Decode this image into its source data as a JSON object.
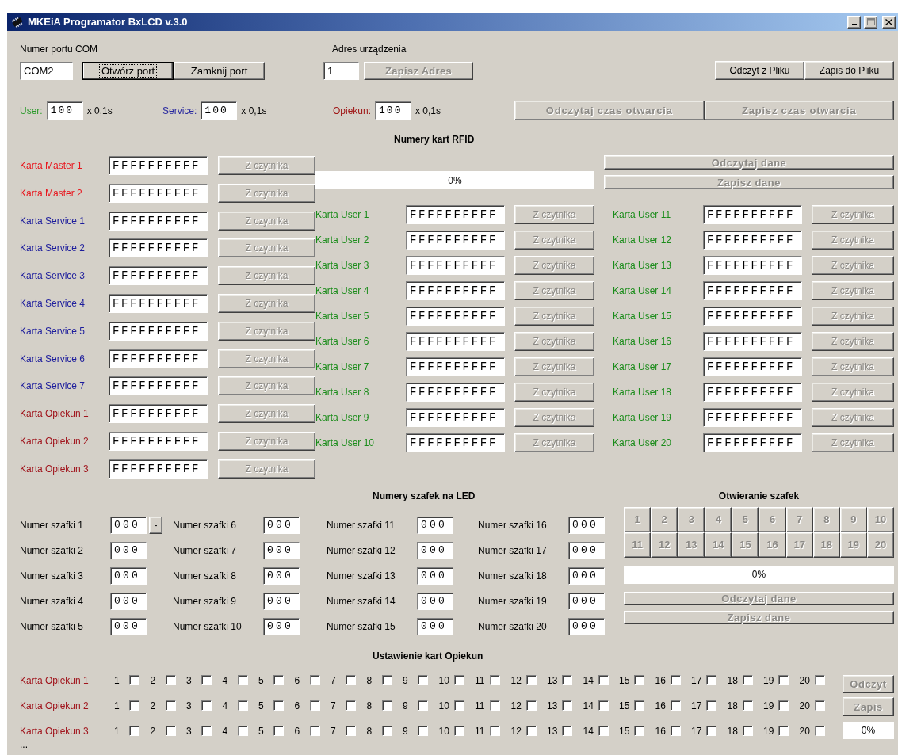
{
  "window": {
    "title": "MKEiA Programator BxLCD v.3.0"
  },
  "com": {
    "label": "Numer portu COM",
    "value": "COM2",
    "buttons": [
      {
        "label": "Otwórz port",
        "focused": true,
        "disabled": false
      },
      {
        "label": "Zamknij port",
        "focused": false,
        "disabled": false
      }
    ]
  },
  "address": {
    "label": "Adres urządzenia",
    "value": "1",
    "button": {
      "label": "Zapisz Adres",
      "focused": false,
      "disabled": true
    }
  },
  "file_buttons": [
    {
      "label": "Odczyt z Pliku",
      "focused": false,
      "disabled": false
    },
    {
      "label": "Zapis do Pliku",
      "focused": false,
      "disabled": false
    }
  ],
  "timers": [
    {
      "label": "User:",
      "value": "100",
      "unit": "x 0,1s",
      "color": "#2a9a2a"
    },
    {
      "label": "Service:",
      "value": "100",
      "unit": "x 0,1s",
      "color": "#2a2aa0"
    },
    {
      "label": "Opiekun:",
      "value": "100",
      "unit": "x 0,1s",
      "color": "#a01818"
    }
  ],
  "timer_buttons": [
    {
      "label": "Odczytaj czas otwarcia",
      "focused": false,
      "disabled": true
    },
    {
      "label": "Zapisz czas otwarcia",
      "focused": false,
      "disabled": true
    }
  ],
  "rfid": {
    "title": "Numery kart RFID",
    "progress": {
      "level": 0,
      "text": "0%"
    },
    "buttons": [
      {
        "label": "Odczytaj dane",
        "focused": false,
        "disabled": true
      },
      {
        "label": "Zapisz dane",
        "focused": false,
        "disabled": true
      }
    ],
    "cards": [
      {
        "label": "Karta Master 1",
        "value": "FFFFFFFFFF",
        "color": "#e8141c",
        "button": {
          "label": "Z czytnika",
          "focused": false,
          "disabled": true
        }
      },
      {
        "label": "Karta Master 2",
        "value": "FFFFFFFFFF",
        "color": "#e8141c",
        "button": {
          "label": "Z czytnika",
          "focused": false,
          "disabled": true
        }
      },
      {
        "label": "Karta Service 1",
        "value": "FFFFFFFFFF",
        "color": "#1c1c9c",
        "button": {
          "label": "Z czytnika",
          "focused": false,
          "disabled": true
        }
      },
      {
        "label": "Karta Service 2",
        "value": "FFFFFFFFFF",
        "color": "#1c1c9c",
        "button": {
          "label": "Z czytnika",
          "focused": false,
          "disabled": true
        }
      },
      {
        "label": "Karta Service 3",
        "value": "FFFFFFFFFF",
        "color": "#1c1c9c",
        "button": {
          "label": "Z czytnika",
          "focused": false,
          "disabled": true
        }
      },
      {
        "label": "Karta Service 4",
        "value": "FFFFFFFFFF",
        "color": "#1c1c9c",
        "button": {
          "label": "Z czytnika",
          "focused": false,
          "disabled": true
        }
      },
      {
        "label": "Karta Service 5",
        "value": "FFFFFFFFFF",
        "color": "#1c1c9c",
        "button": {
          "label": "Z czytnika",
          "focused": false,
          "disabled": true
        }
      },
      {
        "label": "Karta Service 6",
        "value": "FFFFFFFFFF",
        "color": "#1c1c9c",
        "button": {
          "label": "Z czytnika",
          "focused": false,
          "disabled": true
        }
      },
      {
        "label": "Karta Service 7",
        "value": "FFFFFFFFFF",
        "color": "#1c1c9c",
        "button": {
          "label": "Z czytnika",
          "focused": false,
          "disabled": true
        }
      },
      {
        "label": "Karta Opiekun 1",
        "value": "FFFFFFFFFF",
        "color": "#a0141c",
        "button": {
          "label": "Z czytnika",
          "focused": false,
          "disabled": true
        }
      },
      {
        "label": "Karta Opiekun 2",
        "value": "FFFFFFFFFF",
        "color": "#a0141c",
        "button": {
          "label": "Z czytnika",
          "focused": false,
          "disabled": true
        }
      },
      {
        "label": "Karta Opiekun 3",
        "value": "FFFFFFFFFF",
        "color": "#a0141c",
        "button": {
          "label": "Z czytnika",
          "focused": false,
          "disabled": true
        }
      }
    ],
    "user_cards": [
      {
        "label": "Karta User 1",
        "value": "FFFFFFFFFF",
        "color": "#1a8c1a",
        "button": {
          "label": "Z czytnika",
          "focused": false,
          "disabled": true
        }
      },
      {
        "label": "Karta User 2",
        "value": "FFFFFFFFFF",
        "color": "#1a8c1a",
        "button": {
          "label": "Z czytnika",
          "focused": false,
          "disabled": true
        }
      },
      {
        "label": "Karta User 3",
        "value": "FFFFFFFFFF",
        "color": "#1a8c1a",
        "button": {
          "label": "Z czytnika",
          "focused": false,
          "disabled": true
        }
      },
      {
        "label": "Karta User 4",
        "value": "FFFFFFFFFF",
        "color": "#1a8c1a",
        "button": {
          "label": "Z czytnika",
          "focused": false,
          "disabled": true
        }
      },
      {
        "label": "Karta User 5",
        "value": "FFFFFFFFFF",
        "color": "#1a8c1a",
        "button": {
          "label": "Z czytnika",
          "focused": false,
          "disabled": true
        }
      },
      {
        "label": "Karta User 6",
        "value": "FFFFFFFFFF",
        "color": "#1a8c1a",
        "button": {
          "label": "Z czytnika",
          "focused": false,
          "disabled": true
        }
      },
      {
        "label": "Karta User 7",
        "value": "FFFFFFFFFF",
        "color": "#1a8c1a",
        "button": {
          "label": "Z czytnika",
          "focused": false,
          "disabled": true
        }
      },
      {
        "label": "Karta User 8",
        "value": "FFFFFFFFFF",
        "color": "#1a8c1a",
        "button": {
          "label": "Z czytnika",
          "focused": false,
          "disabled": true
        }
      },
      {
        "label": "Karta User 9",
        "value": "FFFFFFFFFF",
        "color": "#1a8c1a",
        "button": {
          "label": "Z czytnika",
          "focused": false,
          "disabled": true
        }
      },
      {
        "label": "Karta User 10",
        "value": "FFFFFFFFFF",
        "color": "#1a8c1a",
        "button": {
          "label": "Z czytnika",
          "focused": false,
          "disabled": true
        }
      },
      {
        "label": "Karta User 11",
        "value": "FFFFFFFFFF",
        "color": "#1a8c1a",
        "button": {
          "label": "Z czytnika",
          "focused": false,
          "disabled": true
        }
      },
      {
        "label": "Karta User 12",
        "value": "FFFFFFFFFF",
        "color": "#1a8c1a",
        "button": {
          "label": "Z czytnika",
          "focused": false,
          "disabled": true
        }
      },
      {
        "label": "Karta User 13",
        "value": "FFFFFFFFFF",
        "color": "#1a8c1a",
        "button": {
          "label": "Z czytnika",
          "focused": false,
          "disabled": true
        }
      },
      {
        "label": "Karta User 14",
        "value": "FFFFFFFFFF",
        "color": "#1a8c1a",
        "button": {
          "label": "Z czytnika",
          "focused": false,
          "disabled": true
        }
      },
      {
        "label": "Karta User 15",
        "value": "FFFFFFFFFF",
        "color": "#1a8c1a",
        "button": {
          "label": "Z czytnika",
          "focused": false,
          "disabled": true
        }
      },
      {
        "label": "Karta User 16",
        "value": "FFFFFFFFFF",
        "color": "#1a8c1a",
        "button": {
          "label": "Z czytnika",
          "focused": false,
          "disabled": true
        }
      },
      {
        "label": "Karta User 17",
        "value": "FFFFFFFFFF",
        "color": "#1a8c1a",
        "button": {
          "label": "Z czytnika",
          "focused": false,
          "disabled": true
        }
      },
      {
        "label": "Karta User 18",
        "value": "FFFFFFFFFF",
        "color": "#1a8c1a",
        "button": {
          "label": "Z czytnika",
          "focused": false,
          "disabled": true
        }
      },
      {
        "label": "Karta User 19",
        "value": "FFFFFFFFFF",
        "color": "#1a8c1a",
        "button": {
          "label": "Z czytnika",
          "focused": false,
          "disabled": true
        }
      },
      {
        "label": "Karta User 20",
        "value": "FFFFFFFFFF",
        "color": "#1a8c1a",
        "button": {
          "label": "Z czytnika",
          "focused": false,
          "disabled": true
        }
      }
    ]
  },
  "led": {
    "title": "Numery szafek na LED",
    "extra_button": {
      "label": "-",
      "focused": false,
      "disabled": false
    },
    "lockers": [
      {
        "label": "Numer szafki 1",
        "value": "000"
      },
      {
        "label": "Numer szafki 2",
        "value": "000"
      },
      {
        "label": "Numer szafki 3",
        "value": "000"
      },
      {
        "label": "Numer szafki 4",
        "value": "000"
      },
      {
        "label": "Numer szafki 5",
        "value": "000"
      },
      {
        "label": "Numer szafki 6",
        "value": "000"
      },
      {
        "label": "Numer szafki 7",
        "value": "000"
      },
      {
        "label": "Numer szafki 8",
        "value": "000"
      },
      {
        "label": "Numer szafki 9",
        "value": "000"
      },
      {
        "label": "Numer szafki 10",
        "value": "000"
      },
      {
        "label": "Numer szafki 11",
        "value": "000"
      },
      {
        "label": "Numer szafki 12",
        "value": "000"
      },
      {
        "label": "Numer szafki 13",
        "value": "000"
      },
      {
        "label": "Numer szafki 14",
        "value": "000"
      },
      {
        "label": "Numer szafki 15",
        "value": "000"
      },
      {
        "label": "Numer szafki 16",
        "value": "000"
      },
      {
        "label": "Numer szafki 17",
        "value": "000"
      },
      {
        "label": "Numer szafki 18",
        "value": "000"
      },
      {
        "label": "Numer szafki 19",
        "value": "000"
      },
      {
        "label": "Numer szafki 20",
        "value": "000"
      }
    ]
  },
  "opening": {
    "title": "Otwieranie szafek",
    "buttons": [
      {
        "label": "1",
        "disabled": true
      },
      {
        "label": "2",
        "disabled": true
      },
      {
        "label": "3",
        "disabled": true
      },
      {
        "label": "4",
        "disabled": true
      },
      {
        "label": "5",
        "disabled": true
      },
      {
        "label": "6",
        "disabled": true
      },
      {
        "label": "7",
        "disabled": true
      },
      {
        "label": "8",
        "disabled": true
      },
      {
        "label": "9",
        "disabled": true
      },
      {
        "label": "10",
        "disabled": true
      },
      {
        "label": "11",
        "disabled": true
      },
      {
        "label": "12",
        "disabled": true
      },
      {
        "label": "13",
        "disabled": true
      },
      {
        "label": "14",
        "disabled": true
      },
      {
        "label": "15",
        "disabled": true
      },
      {
        "label": "16",
        "disabled": true
      },
      {
        "label": "17",
        "disabled": true
      },
      {
        "label": "18",
        "disabled": true
      },
      {
        "label": "19",
        "disabled": true
      },
      {
        "label": "20",
        "disabled": true
      }
    ],
    "progress": {
      "level": 0,
      "text": "0%"
    },
    "actions": [
      {
        "label": "Odczytaj dane",
        "focused": false,
        "disabled": true
      },
      {
        "label": "Zapisz dane",
        "focused": false,
        "disabled": true
      }
    ]
  },
  "guardian": {
    "title": "Ustawienie kart Opiekun",
    "rows": [
      {
        "label": "Karta Opiekun 1",
        "color": "#a0141c",
        "checks": [
          {
            "label": "1",
            "checked": false
          },
          {
            "label": "2",
            "checked": false
          },
          {
            "label": "3",
            "checked": false
          },
          {
            "label": "4",
            "checked": false
          },
          {
            "label": "5",
            "checked": false
          },
          {
            "label": "6",
            "checked": false
          },
          {
            "label": "7",
            "checked": false
          },
          {
            "label": "8",
            "checked": false
          },
          {
            "label": "9",
            "checked": false
          },
          {
            "label": "10",
            "checked": false
          },
          {
            "label": "11",
            "checked": false
          },
          {
            "label": "12",
            "checked": false
          },
          {
            "label": "13",
            "checked": false
          },
          {
            "label": "14",
            "checked": false
          },
          {
            "label": "15",
            "checked": false
          },
          {
            "label": "16",
            "checked": false
          },
          {
            "label": "17",
            "checked": false
          },
          {
            "label": "18",
            "checked": false
          },
          {
            "label": "19",
            "checked": false
          },
          {
            "label": "20",
            "checked": false
          }
        ]
      },
      {
        "label": "Karta Opiekun 2",
        "color": "#a0141c",
        "checks": [
          {
            "label": "1",
            "checked": false
          },
          {
            "label": "2",
            "checked": false
          },
          {
            "label": "3",
            "checked": false
          },
          {
            "label": "4",
            "checked": false
          },
          {
            "label": "5",
            "checked": false
          },
          {
            "label": "6",
            "checked": false
          },
          {
            "label": "7",
            "checked": false
          },
          {
            "label": "8",
            "checked": false
          },
          {
            "label": "9",
            "checked": false
          },
          {
            "label": "10",
            "checked": false
          },
          {
            "label": "11",
            "checked": false
          },
          {
            "label": "12",
            "checked": false
          },
          {
            "label": "13",
            "checked": false
          },
          {
            "label": "14",
            "checked": false
          },
          {
            "label": "15",
            "checked": false
          },
          {
            "label": "16",
            "checked": false
          },
          {
            "label": "17",
            "checked": false
          },
          {
            "label": "18",
            "checked": false
          },
          {
            "label": "19",
            "checked": false
          },
          {
            "label": "20",
            "checked": false
          }
        ]
      },
      {
        "label": "Karta Opiekun 3",
        "color": "#a0141c",
        "checks": [
          {
            "label": "1",
            "checked": false
          },
          {
            "label": "2",
            "checked": false
          },
          {
            "label": "3",
            "checked": false
          },
          {
            "label": "4",
            "checked": false
          },
          {
            "label": "5",
            "checked": false
          },
          {
            "label": "6",
            "checked": false
          },
          {
            "label": "7",
            "checked": false
          },
          {
            "label": "8",
            "checked": false
          },
          {
            "label": "9",
            "checked": false
          },
          {
            "label": "10",
            "checked": false
          },
          {
            "label": "11",
            "checked": false
          },
          {
            "label": "12",
            "checked": false
          },
          {
            "label": "13",
            "checked": false
          },
          {
            "label": "14",
            "checked": false
          },
          {
            "label": "15",
            "checked": false
          },
          {
            "label": "16",
            "checked": false
          },
          {
            "label": "17",
            "checked": false
          },
          {
            "label": "18",
            "checked": false
          },
          {
            "label": "19",
            "checked": false
          },
          {
            "label": "20",
            "checked": false
          }
        ]
      }
    ],
    "buttons": [
      {
        "label": "Odczyt",
        "focused": false,
        "disabled": true
      },
      {
        "label": "Zapis",
        "focused": false,
        "disabled": true
      }
    ],
    "progress": {
      "level": 0,
      "text": "0%"
    }
  },
  "status": "..."
}
